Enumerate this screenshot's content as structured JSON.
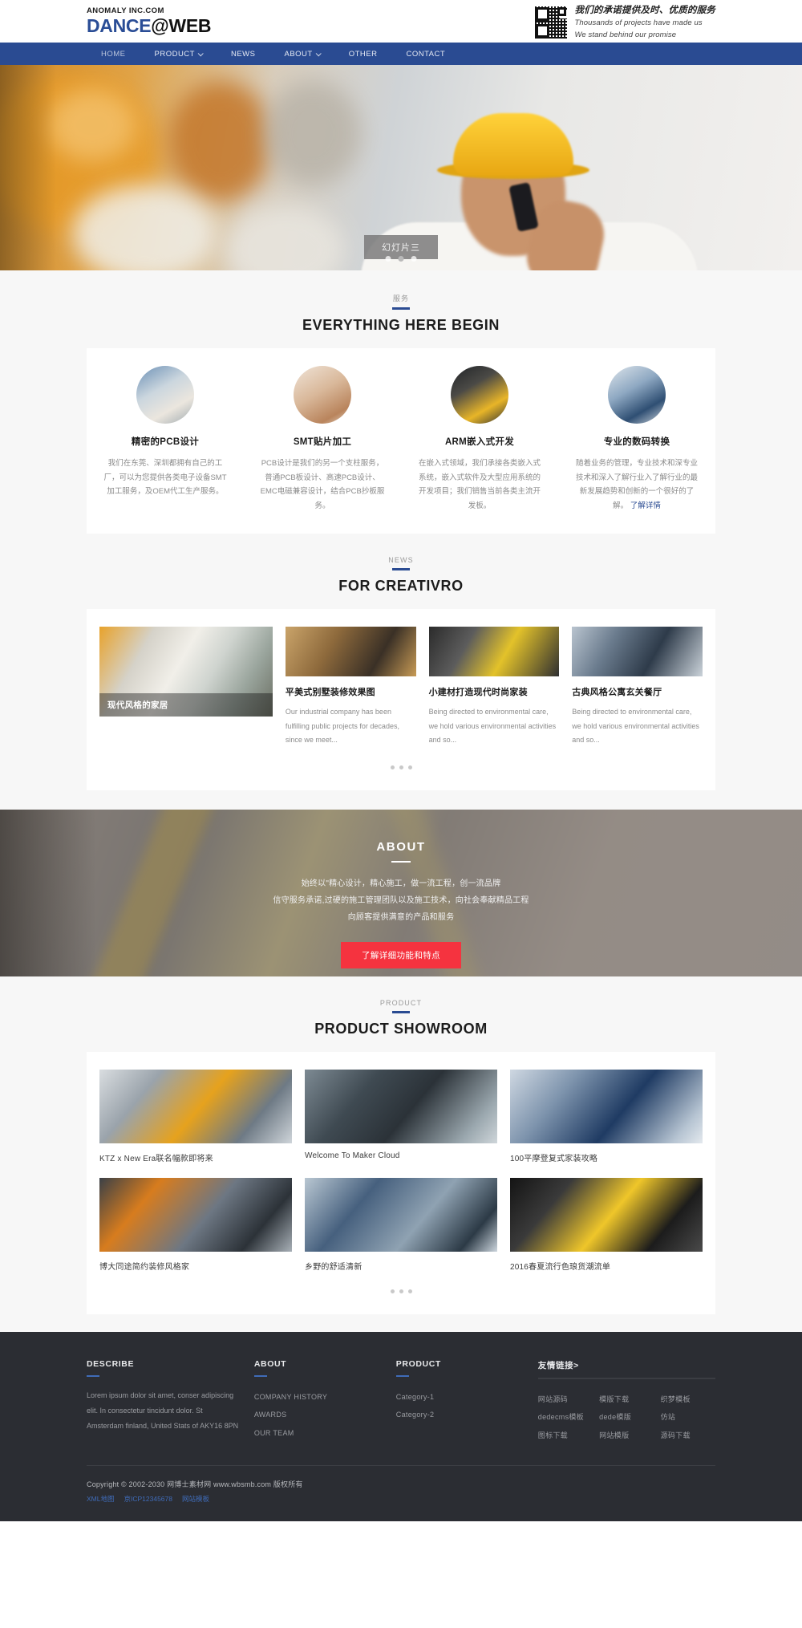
{
  "header": {
    "logo_sub": "ANOMALY INC.COM",
    "logo_blue": "DANCE",
    "logo_dark": "@WEB",
    "promo_cn": "我们的承诺提供及时、优质的服务",
    "promo_en_1": "Thousands of projects have made us",
    "promo_en_2": "We stand behind our promise",
    "qr_icon": "qr-code-icon"
  },
  "nav": {
    "items": [
      {
        "label": "HOME",
        "caret": false
      },
      {
        "label": "PRODUCT",
        "caret": true
      },
      {
        "label": "NEWS",
        "caret": false
      },
      {
        "label": "ABOUT",
        "caret": true
      },
      {
        "label": "OTHER",
        "caret": false
      },
      {
        "label": "CONTACT",
        "caret": false
      }
    ]
  },
  "hero": {
    "caption": "幻灯片三",
    "dots": 3,
    "active_dot": 1
  },
  "services": {
    "kicker": "服务",
    "title": "EVERYTHING HERE BEGIN",
    "cards": [
      {
        "title": "精密的PCB设计",
        "body": "我们在东莞、深圳都拥有自己的工厂，可以为您提供各类电子设备SMT加工服务，及OEM代工生产服务。",
        "link": ""
      },
      {
        "title": "SMT贴片加工",
        "body": "PCB设计是我们的另一个支柱服务，普通PCB板设计、高速PCB设计、EMC电磁兼容设计，结合PCB抄板服务。",
        "link": ""
      },
      {
        "title": "ARM嵌入式开发",
        "body": "在嵌入式领域，我们承接各类嵌入式系统，嵌入式软件及大型应用系统的开发项目；我们销售当前各类主流开发板。",
        "link": ""
      },
      {
        "title": "专业的数码转换",
        "body": "随着业务的管理，专业技术和深专业技术和深入了解行业入了解行业的最新发展趋势和创新的一个很好的了解。",
        "link": "了解详情"
      }
    ]
  },
  "news": {
    "kicker": "NEWS",
    "title": "FOR CREATIVRO",
    "feature": {
      "caption": "现代风格的家居"
    },
    "items": [
      {
        "title": "平美式别墅装修效果图",
        "body": "Our industrial company has been fulfilling public projects for decades, since we meet..."
      },
      {
        "title": "小建材打造现代时尚家装",
        "body": "Being directed to environmental care, we hold various environmental activities and so..."
      },
      {
        "title": "古典风格公寓玄关餐厅",
        "body": "Being directed to environmental care, we hold various environmental activities and so..."
      }
    ],
    "dots": 3
  },
  "about": {
    "title": "ABOUT",
    "line1": "始终以\"精心设计，精心施工，做一流工程，创一流品牌",
    "line2": "信守服务承诺,过硬的施工管理团队以及施工技术，向社会奉献精品工程",
    "line3": "向顾客提供满意的产品和服务",
    "button": "了解详细功能和特点",
    "button_color": "#f5333f"
  },
  "products": {
    "kicker": "PRODUCT",
    "title": "PRODUCT SHOWROOM",
    "items": [
      {
        "title": "KTZ x New Era联名幅款即将来"
      },
      {
        "title": "Welcome To Maker Cloud"
      },
      {
        "title": "100平摩登复式家装攻略"
      },
      {
        "title": "博大同途简约装修风格家"
      },
      {
        "title": "乡野的舒适清新"
      },
      {
        "title": "2016春夏流行色琅货潮流单"
      }
    ],
    "dots": 3
  },
  "footer": {
    "describe": {
      "heading": "DESCRIBE",
      "body": "Lorem ipsum dolor sit amet, conser adipiscing elit. In consectetur tincidunt dolor. St Amsterdam finland, United Stats of AKY16 8PN"
    },
    "about": {
      "heading": "ABOUT",
      "links": [
        "COMPANY HISTORY",
        "AWARDS",
        "OUR TEAM"
      ]
    },
    "product": {
      "heading": "PRODUCT",
      "links": [
        "Category-1",
        "Category-2"
      ]
    },
    "friend_links": {
      "heading": "友情链接>",
      "links": [
        "网站源码",
        "模版下载",
        "织梦模板",
        "dedecms模板",
        "dede模版",
        "仿站",
        "图标下载",
        "网站模版",
        "源码下载"
      ]
    },
    "copyright": "Copyright © 2002-2030 网博士素材网 www.wbsmb.com 版权所有",
    "bottom_links": [
      "XML地图",
      "京ICP12345678",
      "网站模板"
    ],
    "accent": "#3f6bb8"
  }
}
